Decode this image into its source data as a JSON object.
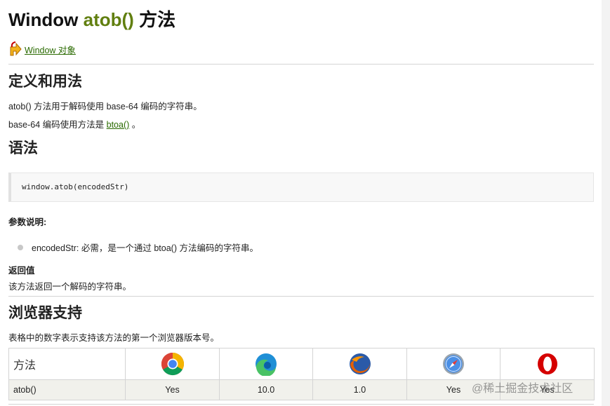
{
  "title": {
    "prefix": "Window ",
    "fn": "atob()",
    "suffix": " 方法"
  },
  "back_link": "Window 对象",
  "sections": {
    "definition": {
      "heading": "定义和用法",
      "p1": "atob() 方法用于解码使用 base-64 编码的字符串。",
      "p2_prefix": "base-64 编码使用方法是 ",
      "p2_link": "btoa()",
      "p2_suffix": " 。"
    },
    "syntax": {
      "heading": "语法",
      "code": "window.atob(encodedStr)",
      "params_label": "参数说明:",
      "param_item": "encodedStr: 必需，是一个通过 btoa() 方法编码的字符串。",
      "return_label": "返回值",
      "return_text": "该方法返回一个解码的字符串。"
    },
    "browser": {
      "heading": "浏览器支持",
      "intro": "表格中的数字表示支持该方法的第一个浏览器版本号。",
      "table": {
        "header_label": "方法",
        "browsers": [
          "chrome-icon",
          "edge-icon",
          "firefox-icon",
          "safari-icon",
          "opera-icon"
        ],
        "row": {
          "method": "atob()",
          "values": [
            "Yes",
            "10.0",
            "1.0",
            "Yes",
            "Yes"
          ]
        }
      }
    }
  },
  "watermark": "@稀土掘金技术社区",
  "colors": {
    "fn_green": "#617f10",
    "link_green": "#2a6a00"
  }
}
